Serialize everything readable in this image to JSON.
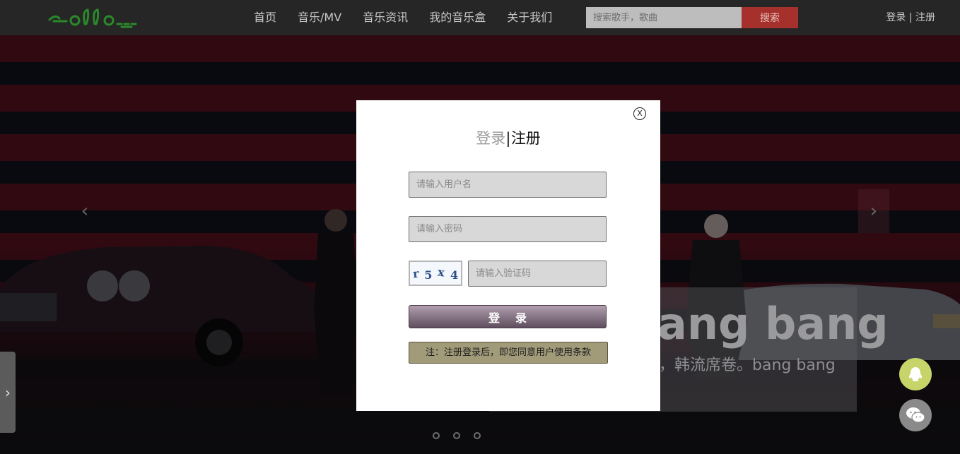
{
  "header": {
    "logo_text": "Hollo",
    "nav": [
      "首页",
      "音乐/MV",
      "音乐资讯",
      "我的音乐盒",
      "关于我们"
    ],
    "search_placeholder": "搜索歌手，歌曲",
    "search_button": "搜索",
    "login_link": "登录",
    "auth_separator": "|",
    "register_link": "注册"
  },
  "banner": {
    "title": "ang bang",
    "subtitle": "，韩流席卷。bang bang",
    "prev_icon": "chevron-left-icon",
    "next_icon": "chevron-right-icon",
    "slide_count": 3
  },
  "side_tab": {
    "icon": "chevron-right-icon"
  },
  "floating_buttons": [
    {
      "name": "qq-button",
      "icon": "qq-icon",
      "color": "#c6d46a"
    },
    {
      "name": "wechat-button",
      "icon": "wechat-icon",
      "color": "#8a8a8a"
    }
  ],
  "modal": {
    "close_label": "X",
    "tab_login": "登录",
    "tab_separator": "|",
    "tab_register": "注册",
    "username_placeholder": "请输入用户名",
    "password_placeholder": "请输入密码",
    "captcha_chars": [
      "r",
      "5",
      "x",
      "4"
    ],
    "captcha_placeholder": "请输入验证码",
    "submit_label": "登录",
    "notice": "注：注册登录后，即您同意用户使用条款"
  },
  "colors": {
    "topbar": "#262626",
    "search_button": "#a6312c",
    "login_button": "#8b7a8a",
    "notice": "#a19b79"
  }
}
